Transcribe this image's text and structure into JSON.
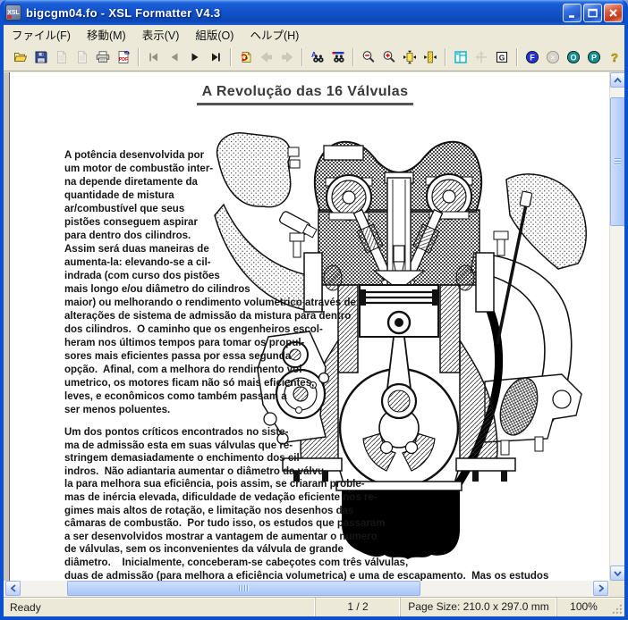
{
  "window": {
    "title": "bigcgm04.fo - XSL Formatter V4.3",
    "icon_text": "XSL"
  },
  "menu": {
    "items": [
      "ファイル(F)",
      "移動(M)",
      "表示(V)",
      "組版(O)",
      "ヘルプ(H)"
    ]
  },
  "toolbar": {
    "buttons": [
      {
        "icon": "open",
        "enabled": true
      },
      {
        "icon": "save",
        "enabled": true
      },
      {
        "icon": "doc-format",
        "enabled": false
      },
      {
        "icon": "doc-result",
        "enabled": false
      },
      {
        "icon": "print",
        "enabled": true
      },
      {
        "icon": "pdf",
        "enabled": true
      },
      {
        "icon": "sep"
      },
      {
        "icon": "first-page",
        "enabled": false
      },
      {
        "icon": "prev-page",
        "enabled": false
      },
      {
        "icon": "next-page",
        "enabled": true
      },
      {
        "icon": "last-page",
        "enabled": true
      },
      {
        "icon": "sep"
      },
      {
        "icon": "goto-page",
        "enabled": true
      },
      {
        "icon": "back",
        "enabled": false
      },
      {
        "icon": "forward",
        "enabled": false
      },
      {
        "icon": "sep"
      },
      {
        "icon": "find",
        "enabled": true
      },
      {
        "icon": "find-format",
        "enabled": true
      },
      {
        "icon": "sep"
      },
      {
        "icon": "zoom-out",
        "enabled": true
      },
      {
        "icon": "zoom-in",
        "enabled": true
      },
      {
        "icon": "fit-page",
        "enabled": true
      },
      {
        "icon": "fit-width",
        "enabled": true
      },
      {
        "icon": "sep"
      },
      {
        "icon": "panel-layout",
        "enabled": true
      },
      {
        "icon": "guides",
        "enabled": false
      },
      {
        "icon": "grid-g",
        "enabled": true,
        "glyph": "G"
      },
      {
        "icon": "sep"
      },
      {
        "icon": "fo-view",
        "enabled": true,
        "glyph": "F",
        "color": "#2233d8"
      },
      {
        "icon": "xml-view",
        "enabled": false,
        "glyph": "×",
        "color": "#b9b7aa"
      },
      {
        "icon": "option-o",
        "enabled": true,
        "glyph": "O",
        "color": "#0e8f96"
      },
      {
        "icon": "option-p",
        "enabled": true,
        "glyph": "P",
        "color": "#0e8f96"
      },
      {
        "icon": "help",
        "enabled": true,
        "glyph": "?"
      }
    ]
  },
  "doc": {
    "title": "A Revolução das 16 Válvulas",
    "para1": [
      "A potência desenvolvida por",
      "um motor de combustão inter-",
      "na depende diretamente da",
      "quantidade de mistura",
      "ar/combustível que seus",
      "pistões conseguem aspirar",
      "para dentro dos cilindros.",
      "Assim será duas maneiras de",
      "aumenta-la: elevando-se a cil-",
      "indrada (com curso dos pistões",
      "mais longo e/ou diâmetro do cilindros",
      "maior) ou melhorando o rendimento volumetrico através de",
      "alterações de sistema de admissão da mistura para dentro",
      "dos cilindros.  O caminho que os engenheiros escol-",
      "heram nos últimos tempos para tomar os propul-",
      "sores mais eficientes passa por essa segunda",
      "opção.  Afinal, com a melhora do rendimento vol-",
      "umetrico, os motores ficam não só mais eficientes,",
      "leves, e econômicos como também passam a",
      "ser menos poluentes."
    ],
    "para2": [
      "Um dos pontos críticos encontrados no siste-",
      "ma de admissão esta em suas válvulas que re-",
      "stringem demasiadamente o enchimento dos cil-",
      "indros.  Não adiantaria aumentar o diâmetro da válvu-",
      "la para melhora sua eficiência, pois assim, se criaram proble-",
      "mas de inércia elevada, dificuldade de vedação eficiente nos re-",
      "gimes mais altos de rotação, e limitação nos desenhos das",
      "câmaras de combustão.  Por tudo isso, os estudos que passaram",
      "a ser desenvolvidos mostrar a vantagem de aumentar o numero",
      "de válvulas, sem os inconvenientes da válvula de grande",
      "diâmetro.    Inicialmente, conceberam-se cabeçotes com três válvulas,",
      "duas de admissão (para melhora a eficiência volumetrica) e uma de escapamento.  Mas os estudos"
    ]
  },
  "statusbar": {
    "status": "Ready",
    "page_indicator": "1 / 2",
    "page_size": "Page Size: 210.0 x 297.0 mm",
    "zoom": "100%"
  }
}
